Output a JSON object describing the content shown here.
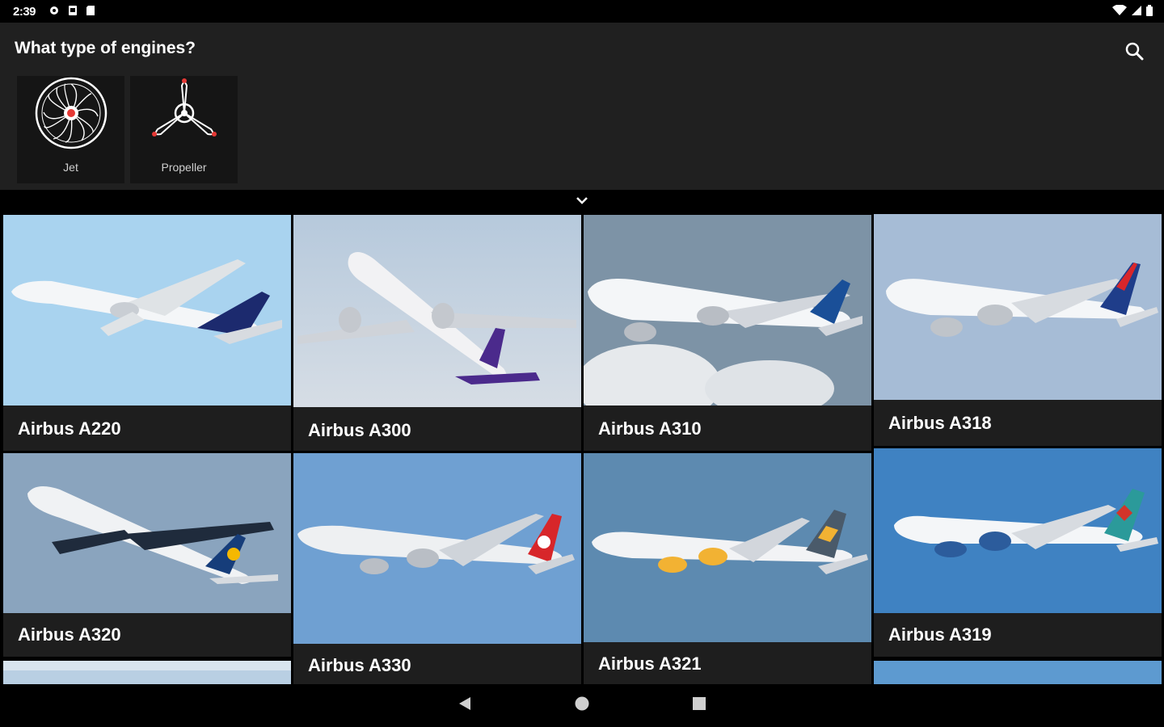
{
  "status_bar": {
    "time": "2:39"
  },
  "filter": {
    "title": "What type of engines?",
    "options": [
      {
        "label": "Jet"
      },
      {
        "label": "Propeller"
      }
    ]
  },
  "aircraft": [
    {
      "name": "Airbus A220"
    },
    {
      "name": "Airbus A300"
    },
    {
      "name": "Airbus A310"
    },
    {
      "name": "Airbus A318"
    },
    {
      "name": "Airbus A320"
    },
    {
      "name": "Airbus A330"
    },
    {
      "name": "Airbus A321"
    },
    {
      "name": "Airbus A319"
    }
  ],
  "colors": {
    "accent": "#e53935",
    "panel": "#202020",
    "card": "#1e1e1e"
  }
}
